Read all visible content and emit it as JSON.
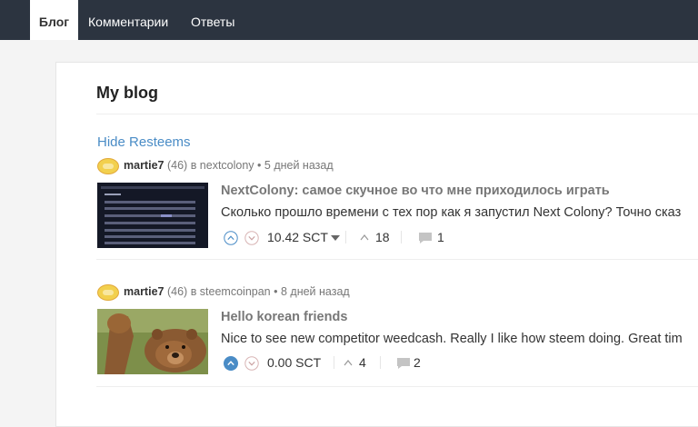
{
  "nav": {
    "tabs": [
      "Блог",
      "Комментарии",
      "Ответы"
    ]
  },
  "main": {
    "title": "My blog",
    "hide_resteems": "Hide Resteems"
  },
  "posts": [
    {
      "author": "martie7",
      "reputation": "(46)",
      "community": "в nextcolony",
      "time": "• 5 дней назад",
      "title": "NextColony: самое скучное во что мне приходилось играть",
      "excerpt": "Сколько прошло времени с тех пор как я запустил Next Colony? Точно сказ",
      "payout": "10.42 SCT",
      "votes": "18",
      "comments": "1"
    },
    {
      "author": "martie7",
      "reputation": "(46)",
      "community": "в steemcoinpan",
      "time": "• 8 дней назад",
      "title": "Hello korean friends",
      "excerpt": "Nice to see new competitor weedcash. Really I like how steem doing. Great tim",
      "payout": "0.00 SCT",
      "votes": "4",
      "comments": "2"
    }
  ],
  "colors": {
    "topbar": "#2c3440",
    "link": "#4a8cc6",
    "upvote_active": "#4a8cc6"
  }
}
